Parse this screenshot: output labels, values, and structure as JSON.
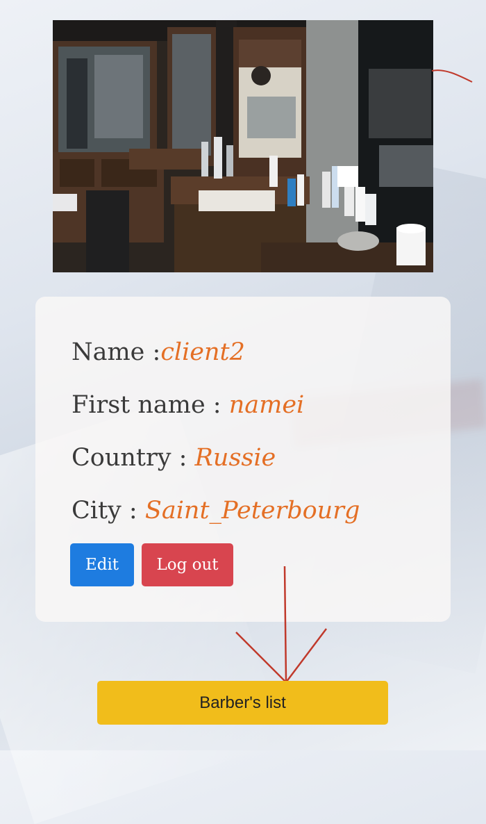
{
  "profile": {
    "name_label": "Name :",
    "name_value": "client2",
    "first_name_label": "First name : ",
    "first_name_value": "namei",
    "country_label": "Country : ",
    "country_value": "Russie",
    "city_label": "City : ",
    "city_value": "Saint_Peterbourg"
  },
  "actions": {
    "edit_label": "Edit",
    "logout_label": "Log out",
    "barbers_list_label": "Barber's list"
  },
  "colors": {
    "value_accent": "#e46f25",
    "edit_button": "#1e7ce0",
    "logout_button": "#d8454f",
    "barbers_button": "#f1bd1b",
    "annotation_arrow": "#c0392b"
  }
}
